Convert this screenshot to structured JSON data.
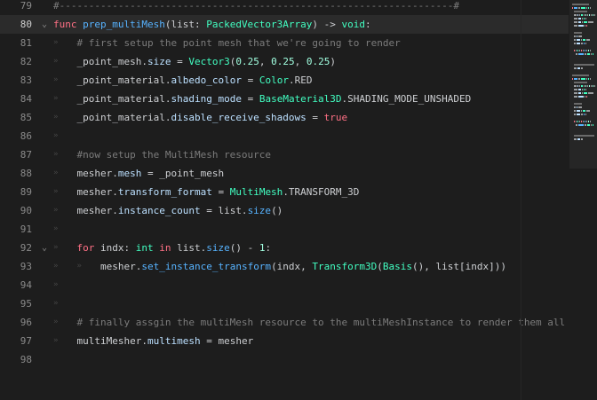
{
  "colors": {
    "background": "#1d1d1d",
    "current_line": "#2b2b2b",
    "comment": "#7c7c7c",
    "keyword": "#ff7085",
    "type": "#42ffc2",
    "member": "#bce0ff",
    "function": "#57b3ff",
    "number": "#a1ffe0",
    "text": "#cdcfd2",
    "line_number": "#8a8a8a"
  },
  "editor": {
    "current_line": 80,
    "lines": [
      {
        "n": "79",
        "fold": "",
        "indent": 0,
        "tokens": [
          {
            "t": "#-------------------------------------------------------------------#",
            "c": "comment"
          }
        ]
      },
      {
        "n": "80",
        "fold": "chevron-down",
        "indent": 0,
        "tokens": [
          {
            "t": "func ",
            "c": "kw"
          },
          {
            "t": "prep_multiMesh",
            "c": "func"
          },
          {
            "t": "(list: ",
            "c": "txt"
          },
          {
            "t": "PackedVector3Array",
            "c": "type"
          },
          {
            "t": ") -> ",
            "c": "txt"
          },
          {
            "t": "void",
            "c": "type"
          },
          {
            "t": ":",
            "c": "txt"
          }
        ]
      },
      {
        "n": "81",
        "fold": "",
        "indent": 1,
        "tokens": [
          {
            "t": "# first setup the point mesh that we're going to render",
            "c": "comment"
          }
        ]
      },
      {
        "n": "82",
        "fold": "",
        "indent": 1,
        "tokens": [
          {
            "t": "_point_mesh.",
            "c": "txt"
          },
          {
            "t": "size",
            "c": "member"
          },
          {
            "t": " = ",
            "c": "txt"
          },
          {
            "t": "Vector3",
            "c": "type"
          },
          {
            "t": "(",
            "c": "txt"
          },
          {
            "t": "0.25",
            "c": "num"
          },
          {
            "t": ", ",
            "c": "txt"
          },
          {
            "t": "0.25",
            "c": "num"
          },
          {
            "t": ", ",
            "c": "txt"
          },
          {
            "t": "0.25",
            "c": "num"
          },
          {
            "t": ")",
            "c": "txt"
          }
        ]
      },
      {
        "n": "83",
        "fold": "",
        "indent": 1,
        "tokens": [
          {
            "t": "_point_material.",
            "c": "txt"
          },
          {
            "t": "albedo_color",
            "c": "member"
          },
          {
            "t": " = ",
            "c": "txt"
          },
          {
            "t": "Color",
            "c": "type"
          },
          {
            "t": ".RED",
            "c": "txt"
          }
        ]
      },
      {
        "n": "84",
        "fold": "",
        "indent": 1,
        "tokens": [
          {
            "t": "_point_material.",
            "c": "txt"
          },
          {
            "t": "shading_mode",
            "c": "member"
          },
          {
            "t": " = ",
            "c": "txt"
          },
          {
            "t": "BaseMaterial3D",
            "c": "type"
          },
          {
            "t": ".SHADING_MODE_UNSHADED",
            "c": "txt"
          }
        ]
      },
      {
        "n": "85",
        "fold": "",
        "indent": 1,
        "tokens": [
          {
            "t": "_point_material.",
            "c": "txt"
          },
          {
            "t": "disable_receive_shadows",
            "c": "member"
          },
          {
            "t": " = ",
            "c": "txt"
          },
          {
            "t": "true",
            "c": "kw"
          }
        ]
      },
      {
        "n": "86",
        "fold": "",
        "indent": 1,
        "tokens": []
      },
      {
        "n": "87",
        "fold": "",
        "indent": 1,
        "tokens": [
          {
            "t": "#now setup the MultiMesh resource",
            "c": "comment"
          }
        ]
      },
      {
        "n": "88",
        "fold": "",
        "indent": 1,
        "tokens": [
          {
            "t": "mesher.",
            "c": "txt"
          },
          {
            "t": "mesh",
            "c": "member"
          },
          {
            "t": " = _point_mesh",
            "c": "txt"
          }
        ]
      },
      {
        "n": "89",
        "fold": "",
        "indent": 1,
        "tokens": [
          {
            "t": "mesher.",
            "c": "txt"
          },
          {
            "t": "transform_format",
            "c": "member"
          },
          {
            "t": " = ",
            "c": "txt"
          },
          {
            "t": "MultiMesh",
            "c": "type"
          },
          {
            "t": ".TRANSFORM_3D",
            "c": "txt"
          }
        ]
      },
      {
        "n": "90",
        "fold": "",
        "indent": 1,
        "tokens": [
          {
            "t": "mesher.",
            "c": "txt"
          },
          {
            "t": "instance_count",
            "c": "member"
          },
          {
            "t": " = list.",
            "c": "txt"
          },
          {
            "t": "size",
            "c": "func"
          },
          {
            "t": "()",
            "c": "txt"
          }
        ]
      },
      {
        "n": "91",
        "fold": "",
        "indent": 1,
        "tokens": []
      },
      {
        "n": "92",
        "fold": "chevron-down",
        "indent": 1,
        "tokens": [
          {
            "t": "for",
            "c": "kw"
          },
          {
            "t": " indx: ",
            "c": "txt"
          },
          {
            "t": "int",
            "c": "type"
          },
          {
            "t": " ",
            "c": "txt"
          },
          {
            "t": "in",
            "c": "kw"
          },
          {
            "t": " list.",
            "c": "txt"
          },
          {
            "t": "size",
            "c": "func"
          },
          {
            "t": "() - ",
            "c": "txt"
          },
          {
            "t": "1",
            "c": "num"
          },
          {
            "t": ":",
            "c": "txt"
          }
        ]
      },
      {
        "n": "93",
        "fold": "",
        "indent": 2,
        "tokens": [
          {
            "t": "mesher.",
            "c": "txt"
          },
          {
            "t": "set_instance_transform",
            "c": "func"
          },
          {
            "t": "(indx, ",
            "c": "txt"
          },
          {
            "t": "Transform3D",
            "c": "type"
          },
          {
            "t": "(",
            "c": "txt"
          },
          {
            "t": "Basis",
            "c": "type"
          },
          {
            "t": "(), list[indx]))",
            "c": "txt"
          }
        ]
      },
      {
        "n": "94",
        "fold": "",
        "indent": 1,
        "tokens": []
      },
      {
        "n": "95",
        "fold": "",
        "indent": 1,
        "tokens": []
      },
      {
        "n": "96",
        "fold": "",
        "indent": 1,
        "tokens": [
          {
            "t": "# finally assgin the multiMesh resource to the multiMeshInstance to render them all",
            "c": "comment"
          }
        ]
      },
      {
        "n": "97",
        "fold": "",
        "indent": 1,
        "tokens": [
          {
            "t": "multiMesher.",
            "c": "txt"
          },
          {
            "t": "multimesh",
            "c": "member"
          },
          {
            "t": " = mesher",
            "c": "txt"
          }
        ]
      },
      {
        "n": "98",
        "fold": "",
        "indent": 0,
        "tokens": []
      }
    ]
  }
}
